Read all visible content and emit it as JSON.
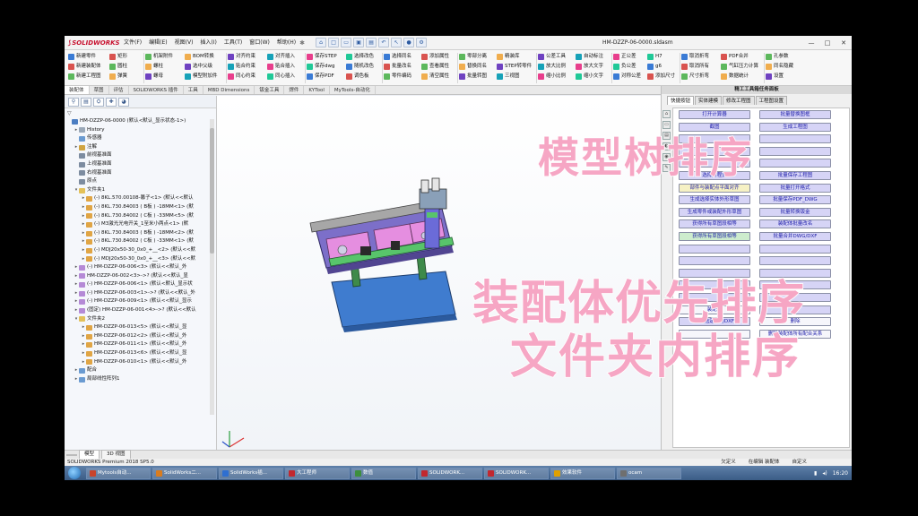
{
  "app": {
    "logo": "SOLIDWORKS",
    "document_title": "HM-DZZP-06-0000.sldasm",
    "menus": [
      "文件(F)",
      "编辑(E)",
      "视图(V)",
      "插入(I)",
      "工具(T)",
      "窗口(W)",
      "帮助(H)"
    ]
  },
  "ribbon": {
    "col1": [
      "新建零件",
      "新建装配体",
      "新建工程图"
    ],
    "col2": [
      "矩形",
      "圆柱",
      "弹簧"
    ],
    "col3": [
      "机架附件",
      "螺柱",
      "螺母"
    ],
    "col4": [
      "BOM转换",
      "选中父级",
      "模型附加件"
    ],
    "col5": [
      "对齐约束",
      "贴合约束",
      "同心约束"
    ],
    "col6": [
      "对齐插入",
      "贴合插入",
      "同心插入"
    ],
    "col7": [
      "保存STEP",
      "保存dwg",
      "保存PDF"
    ],
    "col8": [
      "选择改色",
      "随机改色",
      "调色板"
    ],
    "col9": [
      "选择同名",
      "批量改名",
      "零件编码"
    ],
    "col10": [
      "添加属性",
      "查看属性",
      "清空属性"
    ],
    "col11": [
      "零部分离",
      "替换同名",
      "批量转图"
    ],
    "col12": [
      "精装库",
      "STEP转零件",
      "三视图"
    ],
    "col13": [
      "公差工具",
      "放大比例",
      "缩小比例"
    ],
    "col14": [
      "自动标注",
      "放大文字",
      "缩小文字"
    ],
    "col15": [
      "正公差",
      "负公差",
      "对称公差"
    ],
    "col16": [
      "H7",
      "g6",
      "添加尺寸"
    ],
    "col17": [
      "取消折弯",
      "取消所有",
      "尺寸折弯"
    ],
    "col18": [
      "PDF合并",
      "气缸压力计算",
      "数据统计"
    ],
    "col19": [
      "孔参数",
      "同名隐藏",
      "设置"
    ]
  },
  "command_tabs": [
    "装配体",
    "草图",
    "评估",
    "SOLIDWORKS 插件",
    "工具",
    "MBD Dimensions",
    "钣金工具",
    "焊件",
    "KYTool",
    "MyTools-自动化"
  ],
  "feature_manager": {
    "tabs": [
      "feature-icon",
      "property-icon",
      "config-icon",
      "dim-icon",
      "display-icon"
    ],
    "filter": "▽",
    "tree": [
      {
        "label": "HM-DZZP-06-0000 (默认<默认_显示状态-1>)",
        "depth": 0,
        "arrow": "",
        "icon": "#4c7ec2"
      },
      {
        "label": "History",
        "depth": 1,
        "arrow": "▸",
        "icon": "#9aa8b8"
      },
      {
        "label": "传感器",
        "depth": 1,
        "arrow": "",
        "icon": "#6b9bd1"
      },
      {
        "label": "注解",
        "depth": 1,
        "arrow": "▸",
        "icon": "#d0a441"
      },
      {
        "label": "前视基准面",
        "depth": 1,
        "arrow": "",
        "icon": "#7d8ca0"
      },
      {
        "label": "上视基准面",
        "depth": 1,
        "arrow": "",
        "icon": "#7d8ca0"
      },
      {
        "label": "右视基准面",
        "depth": 1,
        "arrow": "",
        "icon": "#7d8ca0"
      },
      {
        "label": "原点",
        "depth": 1,
        "arrow": "",
        "icon": "#7d8ca0"
      },
      {
        "label": "文件夹1",
        "depth": 1,
        "arrow": "▾",
        "icon": "#e3c15a"
      },
      {
        "label": "(-) 8KL.570.00108-篡子<1> (默认<<默认",
        "depth": 2,
        "arrow": "▸",
        "icon": "#e0a545"
      },
      {
        "label": "(-) 8KL.730.84003 ( B板 ) -18MM<1> (默",
        "depth": 2,
        "arrow": "▸",
        "icon": "#e0a545"
      },
      {
        "label": "(-) 8KL.730.84002 ( C板 ) -33MM<5> (默",
        "depth": 2,
        "arrow": "▸",
        "icon": "#e0a545"
      },
      {
        "label": "(-) M3激光光电开关_1至米小两点<1> (默",
        "depth": 2,
        "arrow": "▸",
        "icon": "#e0a545"
      },
      {
        "label": "(-) 8KL.730.84003 ( B板 ) -18MM<2> (默",
        "depth": 2,
        "arrow": "▸",
        "icon": "#e0a545"
      },
      {
        "label": "(-) 8KL.730.84002 ( C板 ) -33MM<1> (默",
        "depth": 2,
        "arrow": "▸",
        "icon": "#e0a545"
      },
      {
        "label": "(-) MDJ20x50-30_0x0_+__<2> (默认<<默",
        "depth": 2,
        "arrow": "▸",
        "icon": "#e0a545"
      },
      {
        "label": "(-) MDJ20x50-30_0x0_+__<3> (默认<<默",
        "depth": 2,
        "arrow": "▸",
        "icon": "#e0a545"
      },
      {
        "label": "(-) HM-DZZP-06-006<3> (默认<<默认_外",
        "depth": 1,
        "arrow": "▸",
        "icon": "#b58ad6"
      },
      {
        "label": "HM-DZZP-06-002<3>->? (默认<<默认_显",
        "depth": 1,
        "arrow": "▸",
        "icon": "#b58ad6"
      },
      {
        "label": "(-) HM-DZZP-06-006<1> (默认<默认_显示状",
        "depth": 1,
        "arrow": "▸",
        "icon": "#b58ad6"
      },
      {
        "label": "(-) HM-DZZP-06-003<1>->? (默认<<默认_外",
        "depth": 1,
        "arrow": "▸",
        "icon": "#b58ad6"
      },
      {
        "label": "(-) HM-DZZP-06-009<1> (默认<<默认_显示",
        "depth": 1,
        "arrow": "▸",
        "icon": "#b58ad6"
      },
      {
        "label": "(固定) HM-DZZP-06-001<4>->? (默认<<默认",
        "depth": 1,
        "arrow": "▸",
        "icon": "#b58ad6"
      },
      {
        "label": "文件夹2",
        "depth": 1,
        "arrow": "▾",
        "icon": "#e3c15a"
      },
      {
        "label": "HM-DZZP-06-013<5> (默认<<默认_显",
        "depth": 2,
        "arrow": "▸",
        "icon": "#e0a545"
      },
      {
        "label": "HM-DZZP-06-012<2> (默认<<默认_外",
        "depth": 2,
        "arrow": "▸",
        "icon": "#e0a545"
      },
      {
        "label": "HM-DZZP-06-011<1> (默认<<默认_外",
        "depth": 2,
        "arrow": "▸",
        "icon": "#e0a545"
      },
      {
        "label": "HM-DZZP-06-013<6> (默认<<默认_显",
        "depth": 2,
        "arrow": "▸",
        "icon": "#e0a545"
      },
      {
        "label": "HM-DZZP-06-010<1> (默认<<默认_外",
        "depth": 2,
        "arrow": "▸",
        "icon": "#e0a545"
      },
      {
        "label": "配合",
        "depth": 1,
        "arrow": "▸",
        "icon": "#6b9bd1"
      },
      {
        "label": "局部线性阵列1",
        "depth": 1,
        "arrow": "▸",
        "icon": "#6b9bd1"
      }
    ]
  },
  "task_pane": {
    "title": "精工工具箱任务面板",
    "tabs": [
      "快捷按钮",
      "实体建模",
      "修改工程图",
      "工程图设置"
    ],
    "side_icons": [
      "home-icon",
      "folder-icon",
      "library-icon",
      "palette-icon",
      "view-icon",
      "custom-icon"
    ],
    "buttons": [
      {
        "label": "打开计算器",
        "color": "lav"
      },
      {
        "label": "批量替换图框",
        "color": "lav"
      },
      {
        "label": "截图",
        "color": "lav"
      },
      {
        "label": "生成工程图",
        "color": "lav"
      },
      {
        "label": "",
        "color": "lav"
      },
      {
        "label": "",
        "color": "lav"
      },
      {
        "label": "",
        "color": "lav"
      },
      {
        "label": "",
        "color": "lav"
      },
      {
        "label": "",
        "color": "lav"
      },
      {
        "label": "",
        "color": "lav"
      },
      {
        "label": "选择方程式",
        "color": "lav"
      },
      {
        "label": "批量保存工程图",
        "color": "lav"
      },
      {
        "label": "部件与装配点平面对齐",
        "color": "yel"
      },
      {
        "label": "批量打开格式",
        "color": "lav"
      },
      {
        "label": "生成选择实体外形草图",
        "color": "lav"
      },
      {
        "label": "批量保存PDF_DWG",
        "color": "lav"
      },
      {
        "label": "生成零件或装配外形草图",
        "color": "lav"
      },
      {
        "label": "批量转换钣金",
        "color": "lav"
      },
      {
        "label": "获得所有草图段相等",
        "color": "lav"
      },
      {
        "label": "装配体批量改名",
        "color": "lav"
      },
      {
        "label": "获得所有草图段相等",
        "color": "grn"
      },
      {
        "label": "批量合并DWG/DXF",
        "color": "lav"
      },
      {
        "label": "",
        "color": "lav"
      },
      {
        "label": "",
        "color": "lav"
      },
      {
        "label": "",
        "color": "lav"
      },
      {
        "label": "",
        "color": "lav"
      },
      {
        "label": "",
        "color": "lav"
      },
      {
        "label": "",
        "color": "lav"
      },
      {
        "label": "",
        "color": "lav"
      },
      {
        "label": "",
        "color": "lav"
      },
      {
        "label": "",
        "color": "lav"
      },
      {
        "label": "",
        "color": "lav"
      },
      {
        "label": "装配体",
        "color": "wht"
      },
      {
        "label": "",
        "color": "lav"
      },
      {
        "label": "保存选定面为DXF",
        "color": "lav"
      },
      {
        "label": "删除",
        "color": "wht"
      },
      {
        "label": "",
        "color": "wht"
      },
      {
        "label": "删除装配体所有配合关系",
        "color": "wht"
      }
    ]
  },
  "bottom_tabs": [
    "",
    "模型",
    "3D 视图"
  ],
  "status": {
    "left": "SOLIDWORKS Premium 2018 SP5.0",
    "right": [
      "欠定义",
      "在编辑 装配体",
      "自定义"
    ]
  },
  "taskbar": {
    "items": [
      "Mytools自动...",
      "SolidWorks二...",
      "SolidWorks插...",
      "大工程师",
      "数值",
      "SOLIDWORK...",
      "SOLIDWORK...",
      "效果软件",
      "ocam"
    ],
    "time": "16:20"
  },
  "overlays": {
    "line1": "模型树排序",
    "line2": "装配体优先排序",
    "line3": "文件夹内排序"
  },
  "colors": {
    "overlay_pink": "#f6a6c4",
    "plate_purple": "#7c6fc9",
    "part_pink": "#e58ee0",
    "part_green": "#58c46b",
    "base_blue": "#3f7ccf"
  }
}
